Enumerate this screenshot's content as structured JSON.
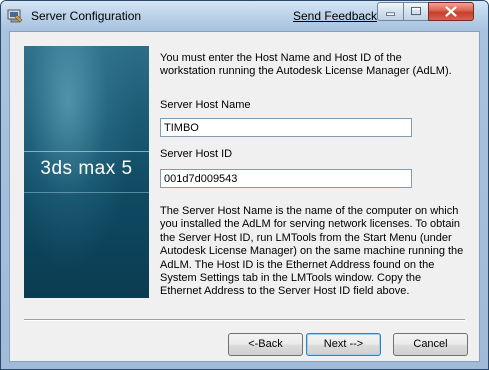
{
  "window": {
    "title": "Server Configuration",
    "feedback_link": "Send Feedback"
  },
  "banner": {
    "product": "3ds max 5"
  },
  "form": {
    "intro": "You must enter the Host Name and Host ID of the workstation running the Autodesk License Manager (AdLM).",
    "host_name_label": "Server Host Name",
    "host_name_value": "TIMBO",
    "host_id_label": "Server Host ID",
    "host_id_value": "001d7d009543",
    "description": "The Server Host Name is the name of the computer on which you installed the AdLM for serving network licenses. To obtain the Server Host ID, run LMTools from the Start Menu (under Autodesk License Manager) on the same machine running the AdLM. The Host ID is the Ethernet Address found on the System Settings tab in the LMTools window. Copy the Ethernet Address to the Server Host ID field above."
  },
  "buttons": {
    "back": "<-Back",
    "next": "Next -->",
    "cancel": "Cancel"
  },
  "colors": {
    "titlebar": "#bcd3ea",
    "banner": "#1b5a73",
    "close_button": "#c5402c"
  }
}
